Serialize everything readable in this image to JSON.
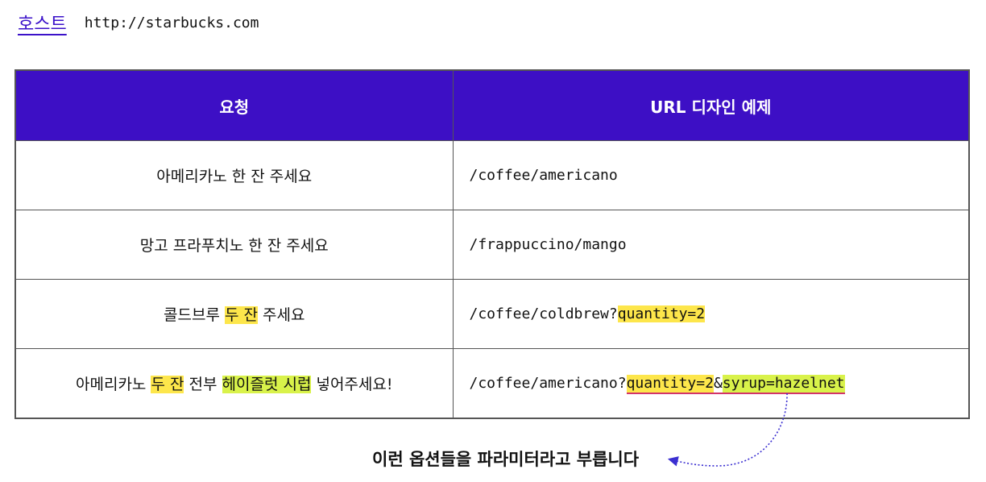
{
  "host": {
    "label": "호스트",
    "url": "http://starbucks.com"
  },
  "table": {
    "headers": [
      "요청",
      "URL 디자인 예제"
    ],
    "rows": [
      {
        "request": [
          {
            "text": "아메리카노 한 잔 주세요"
          }
        ],
        "url": [
          {
            "text": "/coffee/americano"
          }
        ]
      },
      {
        "request": [
          {
            "text": "망고 프라푸치노 한 잔 주세요"
          }
        ],
        "url": [
          {
            "text": "/frappuccino/mango"
          }
        ]
      },
      {
        "request": [
          {
            "text": "콜드브루 "
          },
          {
            "text": "두 잔",
            "highlight": "yellow"
          },
          {
            "text": " 주세요"
          }
        ],
        "url": [
          {
            "text": "/coffee/coldbrew?"
          },
          {
            "text": "quantity=2",
            "highlight": "yellow"
          }
        ]
      },
      {
        "request": [
          {
            "text": "아메리카노 "
          },
          {
            "text": "두 잔",
            "highlight": "yellow"
          },
          {
            "text": " 전부 "
          },
          {
            "text": "헤이즐럿 시럽",
            "highlight": "green"
          },
          {
            "text": " 넣어주세요!"
          }
        ],
        "url": [
          {
            "text": "/coffee/americano?"
          },
          {
            "text": "quantity=2",
            "highlight": "yellow",
            "underline": true
          },
          {
            "text": "&",
            "underline": true
          },
          {
            "text": "syrup=hazelnet",
            "highlight": "green",
            "underline": true
          }
        ]
      }
    ]
  },
  "annotation": {
    "text": "이런 옵션들을 파라미터라고 부릅니다"
  },
  "colors": {
    "header_bg": "#3d0fc5",
    "host_label": "#3b12c9",
    "highlight_yellow": "#fde64b",
    "highlight_green": "#d9f24a",
    "underline": "#d3336a",
    "arrow": "#3b2fd1"
  }
}
